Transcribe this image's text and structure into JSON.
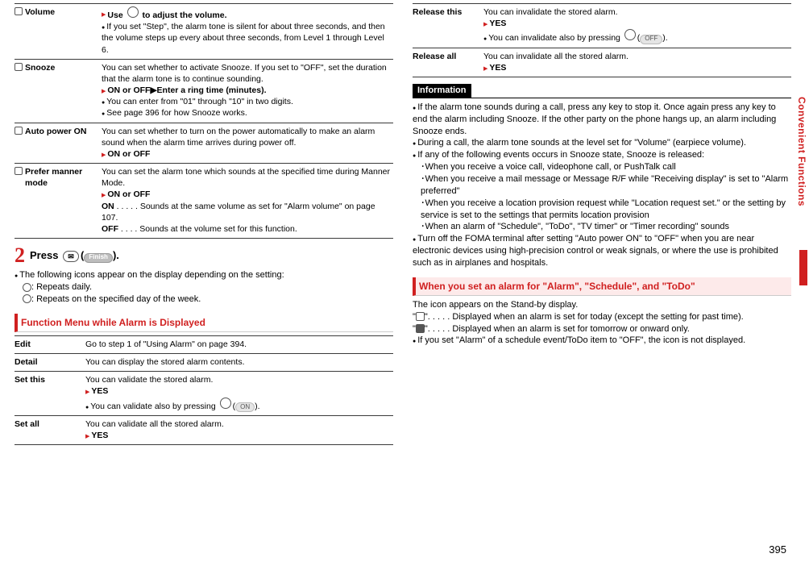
{
  "left": {
    "settings": [
      {
        "title": "Volume",
        "body": [
          {
            "style": "arrow bold",
            "text": "Use ○ to adjust the volume."
          },
          {
            "style": "dot",
            "text": "If you set \"Step\", the alarm tone is silent for about three seconds, and then the volume steps up every about three seconds, from Level 1 through Level 6."
          }
        ]
      },
      {
        "title": "Snooze",
        "body": [
          {
            "text": "You can set whether to activate Snooze. If you set to \"OFF\", set the duration that the alarm tone is to continue sounding."
          },
          {
            "style": "arrow bold",
            "text": "ON or OFF▶Enter a ring time (minutes)."
          },
          {
            "style": "dot",
            "text": "You can enter from \"01\" through \"10\" in two digits."
          },
          {
            "style": "dot",
            "text": "See page 396 for how Snooze works."
          }
        ]
      },
      {
        "title": "Auto power ON",
        "body": [
          {
            "text": "You can set whether to turn on the power automatically to make an alarm sound when the alarm time arrives during power off."
          },
          {
            "style": "arrow bold",
            "text": "ON or OFF"
          }
        ]
      },
      {
        "title": "Prefer manner mode",
        "body": [
          {
            "text": "You can set the alarm tone which sounds at the specified time during Manner Mode."
          },
          {
            "style": "arrow bold",
            "text": "ON or OFF"
          },
          {
            "style": "bold",
            "text": "ON . . . . . Sounds at the same volume as set for \"Alarm volume\" on page 107."
          },
          {
            "style": "bold",
            "text": "OFF . . . . Sounds at the volume set for this function."
          }
        ]
      }
    ],
    "step2": {
      "press": "Press",
      "finish_label": "Finish",
      "after": ".",
      "note": "The following icons appear on the display depending on the setting:",
      "iconD": ": Repeats daily.",
      "iconW": ": Repeats on the specified day of the week."
    },
    "funcmenu_title": "Function Menu while Alarm is Displayed",
    "fm": [
      {
        "title": "Edit",
        "body": [
          {
            "text": "Go to step 1 of \"Using Alarm\" on page 394."
          }
        ]
      },
      {
        "title": "Detail",
        "body": [
          {
            "text": "You can display the stored alarm contents."
          }
        ]
      },
      {
        "title": "Set this",
        "body": [
          {
            "text": "You can validate the stored alarm."
          },
          {
            "style": "arrow bold",
            "text": "YES"
          },
          {
            "style": "dot",
            "text": "You can validate also by pressing ○( ON )."
          }
        ]
      },
      {
        "title": "Set all",
        "body": [
          {
            "text": "You can validate all the stored alarm."
          },
          {
            "style": "arrow bold",
            "text": "YES"
          }
        ]
      }
    ]
  },
  "right": {
    "fm2": [
      {
        "title": "Release this",
        "body": [
          {
            "text": "You can invalidate the stored alarm."
          },
          {
            "style": "arrow bold",
            "text": "YES"
          },
          {
            "style": "dot",
            "text": "You can invalidate also by pressing ○( OFF )."
          }
        ]
      },
      {
        "title": "Release all",
        "body": [
          {
            "text": "You can invalidate all the stored alarm."
          },
          {
            "style": "arrow bold",
            "text": "YES"
          }
        ]
      }
    ],
    "info_label": "Information",
    "info": [
      "If the alarm tone sounds during a call, press any key to stop it. Once again press any key to end the alarm including Snooze. If the other party on the phone hangs up, an alarm including Snooze ends.",
      "During a call, the alarm tone sounds at the level set for \"Volume\" (earpiece volume).",
      "If any of the following events occurs in Snooze state, Snooze is released:"
    ],
    "info_sub": [
      "When you receive a voice call, videophone call, or PushTalk call",
      "When you receive a mail message or Message R/F while \"Receiving display\" is set to \"Alarm preferred\"",
      "When you receive a location provision request while \"Location request set.\" or the setting by service is set to the settings that permits location provision",
      "When an alarm of \"Schedule\", \"ToDo\", \"TV timer\" or \"Timer recording\" sounds"
    ],
    "info_tail": "Turn off the FOMA terminal after setting \"Auto power ON\" to \"OFF\" when you are near electronic devices using high-precision control or weak signals, or where the use is prohibited such as in airplanes and hospitals.",
    "when_title": "When you set an alarm for \"Alarm\", \"Schedule\", and \"ToDo\"",
    "when_body": [
      "The icon appears on the Stand-by display.",
      "\"△\". . . . . Displayed when an alarm is set for today (except the setting for past time).",
      "\"▲\". . . . . Displayed when an alarm is set for tomorrow or onward only."
    ],
    "when_note": "If you set \"Alarm\" of a schedule event/ToDo item to \"OFF\", the icon is not displayed."
  },
  "tab_label": "Convenient Functions",
  "page_num": "395"
}
